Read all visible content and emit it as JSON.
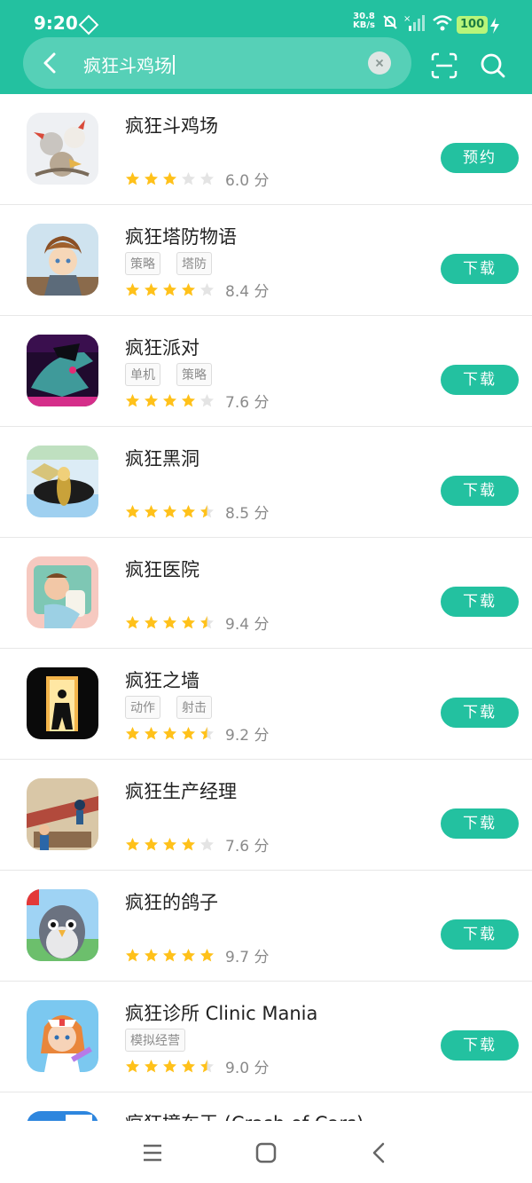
{
  "status_bar": {
    "time": "9:20",
    "net_speed_value": "30.8",
    "net_speed_unit": "KB/s",
    "battery": "100"
  },
  "search": {
    "query": "疯狂斗鸡场"
  },
  "apps": [
    {
      "title": "疯狂斗鸡场",
      "tags": [],
      "rating": 3,
      "score": "6.0 分",
      "action": "预约",
      "icon": "rooster-fight-icon"
    },
    {
      "title": "疯狂塔防物语",
      "tags": [
        "策略",
        "塔防"
      ],
      "rating": 4,
      "score": "8.4 分",
      "action": "下载",
      "icon": "anime-hero-icon"
    },
    {
      "title": "疯狂派对",
      "tags": [
        "单机",
        "策略"
      ],
      "rating": 4,
      "score": "7.6 分",
      "action": "下载",
      "icon": "neon-face-icon"
    },
    {
      "title": "疯狂黑洞",
      "tags": [],
      "rating": 4.5,
      "score": "8.5 分",
      "action": "下载",
      "icon": "black-hole-icon"
    },
    {
      "title": "疯狂医院",
      "tags": [],
      "rating": 4.5,
      "score": "9.4 分",
      "action": "下载",
      "icon": "baby-hospital-icon"
    },
    {
      "title": "疯狂之墙",
      "tags": [
        "动作",
        "射击"
      ],
      "rating": 4.5,
      "score": "9.2 分",
      "action": "下载",
      "icon": "doorway-silhouette-icon"
    },
    {
      "title": "疯狂生产经理",
      "tags": [],
      "rating": 4,
      "score": "7.6 分",
      "action": "下载",
      "icon": "factory-line-icon"
    },
    {
      "title": "疯狂的鸽子",
      "tags": [],
      "rating": 5,
      "score": "9.7 分",
      "action": "下载",
      "icon": "pigeon-icon"
    },
    {
      "title": "疯狂诊所 Clinic Mania",
      "tags": [
        "模拟经营"
      ],
      "rating": 4.5,
      "score": "9.0 分",
      "action": "下载",
      "icon": "nurse-icon"
    }
  ],
  "partial_app": {
    "title": "疯狂撞车王 (Crash of Cars)",
    "icon": "crash-cars-icon"
  },
  "colors": {
    "accent": "#23c1a0",
    "star_filled": "#ffc11a",
    "star_empty": "#e4e4e4"
  }
}
